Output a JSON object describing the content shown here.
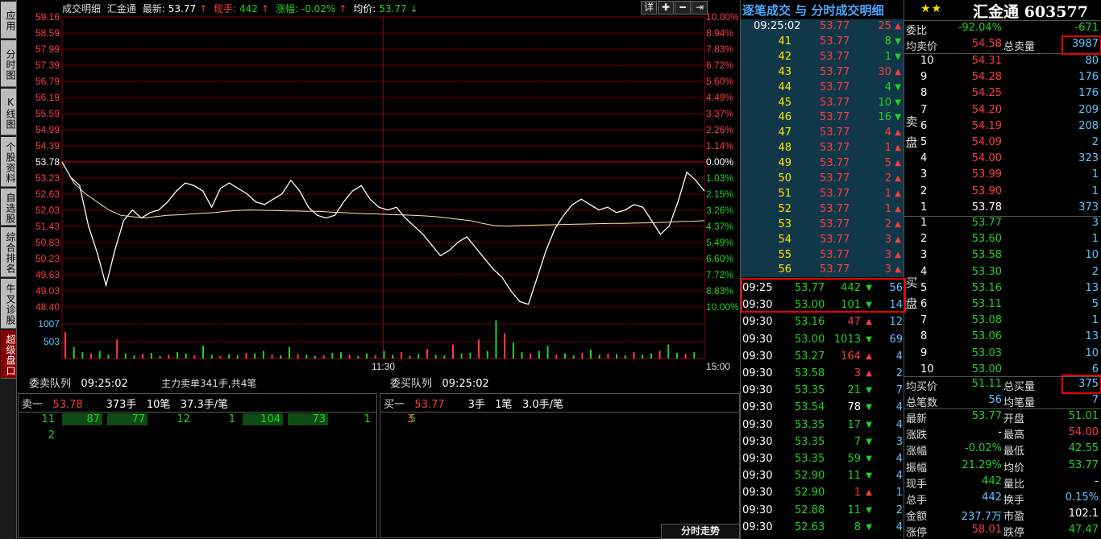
{
  "nav": [
    {
      "label": "应用",
      "active": false
    },
    {
      "label": "分时图",
      "active": false
    },
    {
      "label": "K线图",
      "active": false
    },
    {
      "label": "个股资料",
      "active": false
    },
    {
      "label": "自选股",
      "active": false
    },
    {
      "label": "综合排名",
      "active": false
    },
    {
      "label": "牛叉诊股",
      "active": false
    },
    {
      "label": "超级盘口",
      "active": true
    }
  ],
  "chart_header": {
    "mode": "成交明细",
    "name": "汇金通",
    "latest_label": "最新:",
    "latest": "53.77",
    "latest_arrow": "↑",
    "volume_label": "现手:",
    "volume": "442",
    "volume_arrow": "↑",
    "change_label": "涨幅:",
    "change": "-0.02%",
    "change_arrow": "↑",
    "avg_label": "均价:",
    "avg": "53.77",
    "avg_arrow": "↓"
  },
  "toolbar": {
    "detail": "详",
    "plus": "✚",
    "minus": "━",
    "expand": "⇥"
  },
  "chart_data": {
    "type": "line",
    "title": "",
    "price_ticks": [
      "59.16",
      "58.59",
      "57.99",
      "57.39",
      "56.79",
      "56.19",
      "55.59",
      "54.99",
      "54.39",
      "53.78",
      "53.23",
      "52.63",
      "52.03",
      "51.43",
      "50.83",
      "50.23",
      "49.63",
      "49.03",
      "48.40"
    ],
    "pct_ticks": [
      "10.00%",
      "8.94%",
      "7.83%",
      "6.72%",
      "5.60%",
      "4.49%",
      "3.37%",
      "2.26%",
      "1.14%",
      "0.00%",
      "1.03%",
      "2.15%",
      "3.26%",
      "4.37%",
      "5.49%",
      "6.60%",
      "7.72%",
      "8.83%",
      "10.00%"
    ],
    "vol_ticks": [
      "1007",
      "503"
    ],
    "time_ticks": [
      "11:30",
      "15:00"
    ],
    "ylim": [
      48.4,
      59.16
    ],
    "prev_close": 53.78,
    "series": [
      {
        "values": [
          53.78,
          53.2,
          52.9,
          51.4,
          50.4,
          49.2,
          50.5,
          51.6,
          52.0,
          51.7,
          51.9,
          52.0,
          52.3,
          52.7,
          53.0,
          52.9,
          52.7,
          52.1,
          52.8,
          53.0,
          52.8,
          52.6,
          52.3,
          52.2,
          52.4,
          52.6,
          53.1,
          52.7,
          52.1,
          51.8,
          51.7,
          51.8,
          52.3,
          52.7,
          52.9,
          52.4,
          52.1,
          52.0,
          52.1,
          51.7,
          51.4,
          51.1,
          50.7,
          50.3,
          50.5,
          50.8,
          51.0,
          50.6,
          50.2,
          49.8,
          49.5,
          49.0,
          48.6,
          48.5,
          49.5,
          50.5,
          51.3,
          51.8,
          52.2,
          52.4,
          52.2,
          52.0,
          52.1,
          51.9,
          52.0,
          52.2,
          52.1,
          51.6,
          51.1,
          51.4,
          52.3,
          53.4,
          53.1,
          52.7
        ]
      },
      {
        "values": [
          53.78,
          53.0,
          52.6,
          52.3,
          52.0,
          51.8,
          51.75,
          51.7,
          51.75,
          51.8,
          51.82,
          51.85,
          51.88,
          51.9,
          51.95,
          51.98,
          52.0,
          51.99,
          51.98,
          51.97,
          51.96,
          51.95,
          51.95,
          51.92,
          51.9,
          51.88,
          51.86,
          51.85,
          51.83,
          51.82,
          51.8,
          51.78,
          51.75,
          51.7,
          51.65,
          51.6,
          51.5,
          51.42,
          51.4,
          51.42,
          51.43,
          51.44,
          51.45,
          51.46,
          51.47,
          51.48,
          51.49,
          51.5,
          51.5,
          51.51,
          51.52,
          51.53,
          51.55,
          51.57,
          51.58,
          51.6
        ]
      }
    ],
    "volume": [
      42,
      18,
      10,
      8,
      12,
      6,
      30,
      8,
      5,
      7,
      9,
      4,
      6,
      10,
      8,
      5,
      20,
      6,
      4,
      7,
      5,
      9,
      8,
      12,
      6,
      5,
      18,
      7,
      6,
      4,
      5,
      9,
      10,
      6,
      4,
      8,
      5,
      12,
      6,
      10,
      4,
      7,
      15,
      6,
      5,
      22,
      8,
      9,
      30,
      12,
      60,
      40,
      25,
      10,
      8,
      12,
      20,
      6,
      8,
      5,
      9,
      14,
      6,
      8,
      7,
      5,
      10,
      6,
      8,
      12,
      22,
      9,
      7,
      10
    ]
  },
  "queue": {
    "sell_title": "委卖队列",
    "sell_time": "09:25:02",
    "main_note": "主力卖单341手,共4笔",
    "buy_title": "委买队列",
    "buy_time": "09:25:02",
    "sell1": {
      "label": "卖一",
      "price": "53.78",
      "qty": "373手",
      "cnt": "10笔",
      "avg": "37.3手/笔"
    },
    "buy1": {
      "label": "买一",
      "price": "53.77",
      "qty": "3手",
      "cnt": "1笔",
      "avg": "3.0手/笔"
    },
    "sell_cells": [
      {
        "v": "11",
        "hl": false
      },
      {
        "v": "87",
        "hl": true
      },
      {
        "v": "77",
        "hl": true
      },
      {
        "v": "12",
        "hl": false
      },
      {
        "v": "1",
        "hl": false
      },
      {
        "v": "104",
        "hl": true
      },
      {
        "v": "73",
        "hl": true
      },
      {
        "v": "1",
        "hl": false
      },
      {
        "v": "5",
        "hl": false
      }
    ],
    "sell_cells2": [
      {
        "v": "2",
        "hl": false
      }
    ],
    "buy_cells": [
      {
        "v": "3",
        "hl": false
      }
    ]
  },
  "trades": {
    "title": "逐笔成交 与 分时成交明细",
    "footer": "分时走势",
    "tick_rows": [
      {
        "t": "09:25:02",
        "p": "53.77",
        "v": "25",
        "dir": "up"
      },
      {
        "t": "41",
        "p": "53.77",
        "v": "8",
        "dir": "down"
      },
      {
        "t": "42",
        "p": "53.77",
        "v": "1",
        "dir": "down"
      },
      {
        "t": "43",
        "p": "53.77",
        "v": "30",
        "dir": "up"
      },
      {
        "t": "44",
        "p": "53.77",
        "v": "4",
        "dir": "down"
      },
      {
        "t": "45",
        "p": "53.77",
        "v": "10",
        "dir": "down"
      },
      {
        "t": "46",
        "p": "53.77",
        "v": "16",
        "dir": "down"
      },
      {
        "t": "47",
        "p": "53.77",
        "v": "4",
        "dir": "up"
      },
      {
        "t": "48",
        "p": "53.77",
        "v": "1",
        "dir": "up"
      },
      {
        "t": "49",
        "p": "53.77",
        "v": "5",
        "dir": "up"
      },
      {
        "t": "50",
        "p": "53.77",
        "v": "2",
        "dir": "up"
      },
      {
        "t": "51",
        "p": "53.77",
        "v": "1",
        "dir": "up"
      },
      {
        "t": "52",
        "p": "53.77",
        "v": "1",
        "dir": "up"
      },
      {
        "t": "53",
        "p": "53.77",
        "v": "2",
        "dir": "up"
      },
      {
        "t": "54",
        "p": "53.77",
        "v": "3",
        "dir": "up"
      },
      {
        "t": "55",
        "p": "53.77",
        "v": "3",
        "dir": "up"
      },
      {
        "t": "56",
        "p": "53.77",
        "v": "3",
        "dir": "up"
      }
    ],
    "minute_rows": [
      {
        "t": "09:25",
        "p": "53.77",
        "pc": "green",
        "v": "442",
        "dir": "down",
        "n": "56"
      },
      {
        "t": "09:30",
        "p": "53.00",
        "pc": "green",
        "v": "101",
        "dir": "down",
        "n": "14"
      },
      {
        "t": "09:30",
        "p": "53.16",
        "pc": "green",
        "v": "47",
        "dir": "up",
        "n": "12"
      },
      {
        "t": "09:30",
        "p": "53.00",
        "pc": "green",
        "v": "1013",
        "dir": "down",
        "n": "69"
      },
      {
        "t": "09:30",
        "p": "53.27",
        "pc": "green",
        "v": "164",
        "dir": "up",
        "n": "4"
      },
      {
        "t": "09:30",
        "p": "53.58",
        "pc": "green",
        "v": "3",
        "dir": "up",
        "n": "2"
      },
      {
        "t": "09:30",
        "p": "53.35",
        "pc": "green",
        "v": "21",
        "dir": "down",
        "n": "7"
      },
      {
        "t": "09:30",
        "p": "53.54",
        "pc": "green",
        "v": "78",
        "dir": "down",
        "n": "4"
      },
      {
        "t": "09:30",
        "p": "53.35",
        "pc": "green",
        "v": "17",
        "dir": "down",
        "n": "4"
      },
      {
        "t": "09:30",
        "p": "53.35",
        "pc": "green",
        "v": "7",
        "dir": "down",
        "n": "3"
      },
      {
        "t": "09:30",
        "p": "53.35",
        "pc": "green",
        "v": "59",
        "dir": "down",
        "n": "4"
      },
      {
        "t": "09:30",
        "p": "52.90",
        "pc": "green",
        "v": "11",
        "dir": "down",
        "n": "4"
      },
      {
        "t": "09:30",
        "p": "52.90",
        "pc": "green",
        "v": "1",
        "dir": "up",
        "n": "1"
      },
      {
        "t": "09:30",
        "p": "52.88",
        "pc": "green",
        "v": "11",
        "dir": "down",
        "n": "2"
      },
      {
        "t": "09:30",
        "p": "52.63",
        "pc": "green",
        "v": "8",
        "dir": "down",
        "n": "4"
      }
    ]
  },
  "quote": {
    "stars": "★★",
    "title": "汇金通 603577",
    "weibi_label": "委比",
    "weibi": "-92.04%",
    "weicha": "-671",
    "avg_sell_label": "均卖价",
    "avg_sell": "54.58",
    "total_sell_label": "总卖量",
    "total_sell": "3987",
    "sell_side_label": "卖盘",
    "buy_side_label": "买盘",
    "asks": [
      {
        "lv": "10",
        "p": "54.31",
        "v": "80"
      },
      {
        "lv": "9",
        "p": "54.28",
        "v": "176"
      },
      {
        "lv": "8",
        "p": "54.25",
        "v": "176"
      },
      {
        "lv": "7",
        "p": "54.20",
        "v": "209"
      },
      {
        "lv": "6",
        "p": "54.19",
        "v": "208"
      },
      {
        "lv": "5",
        "p": "54.09",
        "v": "2"
      },
      {
        "lv": "4",
        "p": "54.00",
        "v": "323"
      },
      {
        "lv": "3",
        "p": "53.99",
        "v": "1"
      },
      {
        "lv": "2",
        "p": "53.90",
        "v": "1"
      },
      {
        "lv": "1",
        "p": "53.78",
        "v": "373"
      }
    ],
    "bids": [
      {
        "lv": "1",
        "p": "53.77",
        "v": "3"
      },
      {
        "lv": "2",
        "p": "53.60",
        "v": "1"
      },
      {
        "lv": "3",
        "p": "53.58",
        "v": "10"
      },
      {
        "lv": "4",
        "p": "53.30",
        "v": "2"
      },
      {
        "lv": "5",
        "p": "53.16",
        "v": "13"
      },
      {
        "lv": "6",
        "p": "53.11",
        "v": "5"
      },
      {
        "lv": "7",
        "p": "53.08",
        "v": "1"
      },
      {
        "lv": "8",
        "p": "53.06",
        "v": "13"
      },
      {
        "lv": "9",
        "p": "53.03",
        "v": "10"
      },
      {
        "lv": "10",
        "p": "53.00",
        "v": "6"
      }
    ],
    "avg_buy_label": "均买价",
    "avg_buy": "51.11",
    "total_buy_label": "总买量",
    "total_buy": "375",
    "total_cnt_label": "总笔数",
    "total_cnt": "56",
    "avg_cnt_label": "均笔量",
    "avg_cnt": "7",
    "stats": [
      {
        "l1": "最新",
        "v1": "53.77",
        "c1": "green",
        "l2": "开盘",
        "v2": "51.01",
        "c2": "green"
      },
      {
        "l1": "涨跌",
        "v1": "-",
        "c1": "white",
        "l2": "最高",
        "v2": "54.00",
        "c2": "red"
      },
      {
        "l1": "涨幅",
        "v1": "-0.02%",
        "c1": "green",
        "l2": "最低",
        "v2": "42.55",
        "c2": "green"
      },
      {
        "l1": "振幅",
        "v1": "21.29%",
        "c1": "green",
        "l2": "均价",
        "v2": "53.77",
        "c2": "green"
      },
      {
        "l1": "现手",
        "v1": "442",
        "c1": "green",
        "l2": "量比",
        "v2": "-",
        "c2": "white"
      },
      {
        "l1": "总手",
        "v1": "442",
        "c1": "cyan",
        "l2": "换手",
        "v2": "0.15%",
        "c2": "cyan"
      },
      {
        "l1": "金额",
        "v1": "237.7万",
        "c1": "cyan",
        "l2": "市盈",
        "v2": "102.1",
        "c2": "white"
      },
      {
        "l1": "涨停",
        "v1": "58.01",
        "c1": "red",
        "l2": "跌停",
        "v2": "47.47",
        "c2": "green"
      }
    ]
  },
  "colors": {
    "up": "#ff3d3d",
    "down": "#21d321",
    "accent": "#ffe400",
    "grid": "#8c0000"
  }
}
